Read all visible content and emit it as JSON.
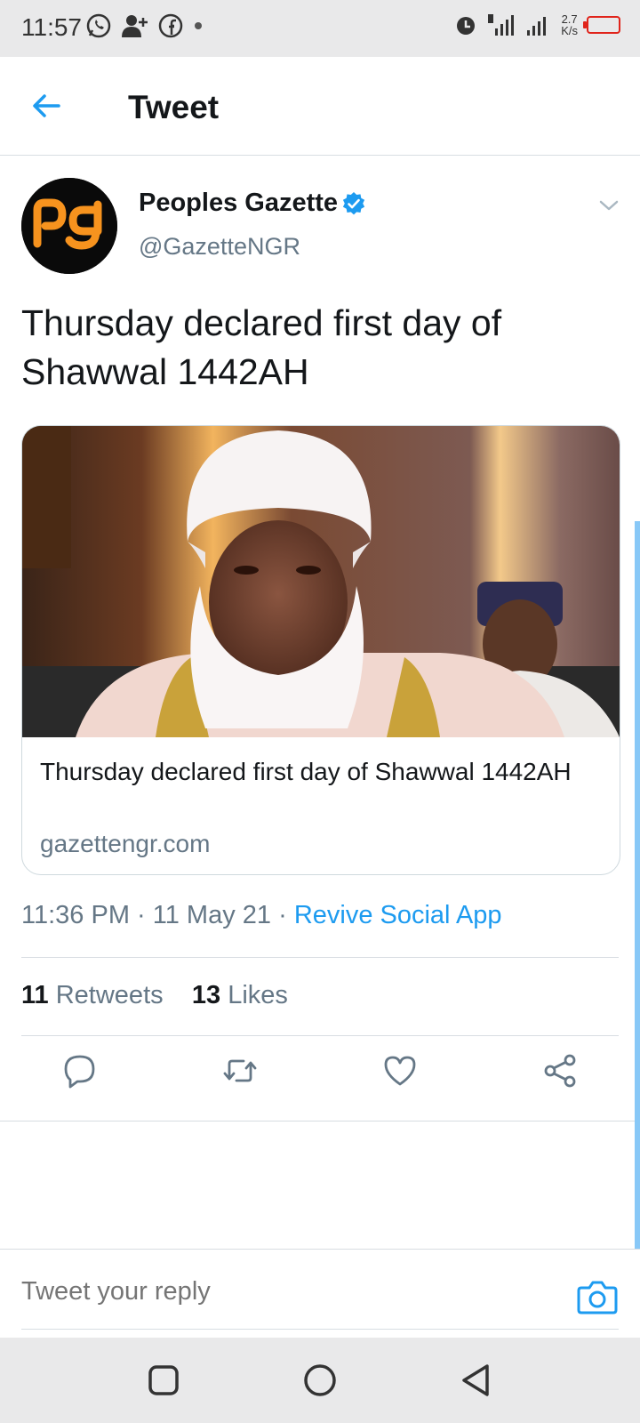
{
  "status_bar": {
    "time": "11:57",
    "left_icons": [
      "whatsapp-icon",
      "add-contact-icon",
      "facebook-icon",
      "dot-icon"
    ],
    "right_icons": [
      "alarm-icon",
      "signal-3g-icon",
      "signal-icon",
      "battery-icon"
    ],
    "speed_value": "2.7",
    "speed_unit": "K/s"
  },
  "header": {
    "title": "Tweet"
  },
  "tweet": {
    "author_name": "Peoples Gazette",
    "handle": "@GazetteNGR",
    "verified": true,
    "text": "Thursday declared first day of Shawwal 1442AH",
    "card": {
      "title": "Thursday declared first day of Shawwal 1442AH",
      "domain": "gazettengr.com"
    },
    "meta": {
      "time": "11:36 PM",
      "sep1": " · ",
      "date": "11 May 21",
      "sep2": " · ",
      "app": "Revive Social App"
    },
    "stats": {
      "retweets_count": "11",
      "retweets_label": "Retweets",
      "likes_count": "13",
      "likes_label": "Likes"
    }
  },
  "reply": {
    "placeholder": "Tweet your reply"
  },
  "colors": {
    "accent": "#1d9bf0",
    "avatar_orange": "#f7931e",
    "muted": "#657786"
  }
}
